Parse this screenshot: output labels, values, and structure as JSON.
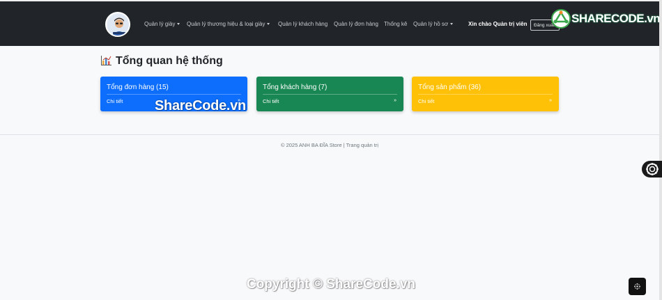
{
  "navbar": {
    "items": [
      {
        "label": "Quản lý giày",
        "dropdown": true
      },
      {
        "label": "Quản lý thương hiệu & loại giày",
        "dropdown": true
      },
      {
        "label": "Quản lý khách hàng",
        "dropdown": false
      },
      {
        "label": "Quản lý đơn hàng",
        "dropdown": false
      },
      {
        "label": "Thống kê",
        "dropdown": false
      },
      {
        "label": "Quản lý hồ sơ",
        "dropdown": true
      }
    ],
    "greeting": "Xin chào Quản trị viên",
    "logout_label": "Đăng xuất"
  },
  "watermarks": {
    "brand": "SHARECODE.vn",
    "center": "ShareCode.vn",
    "bottom": "Copyright © ShareCode.vn"
  },
  "main": {
    "title": "Tổng quan hệ thống",
    "title_icon": "bar-chart-icon",
    "cards": [
      {
        "title": "Tổng đơn hàng (15)",
        "link": "Chi tiết",
        "arrow": "»",
        "color": "#0d6efd"
      },
      {
        "title": "Tổng khách hàng (7)",
        "link": "Chi tiết",
        "arrow": "»",
        "color": "#198754"
      },
      {
        "title": "Tổng sản phẩm (36)",
        "link": "Chi tiết",
        "arrow": "»",
        "color": "#ffc107"
      }
    ]
  },
  "footer": {
    "text": "© 2025 ANH BA ĐĨA Store | Trang quản trị"
  },
  "colors": {
    "navbar_bg": "#212529",
    "page_bg": "#f8f9fa"
  }
}
